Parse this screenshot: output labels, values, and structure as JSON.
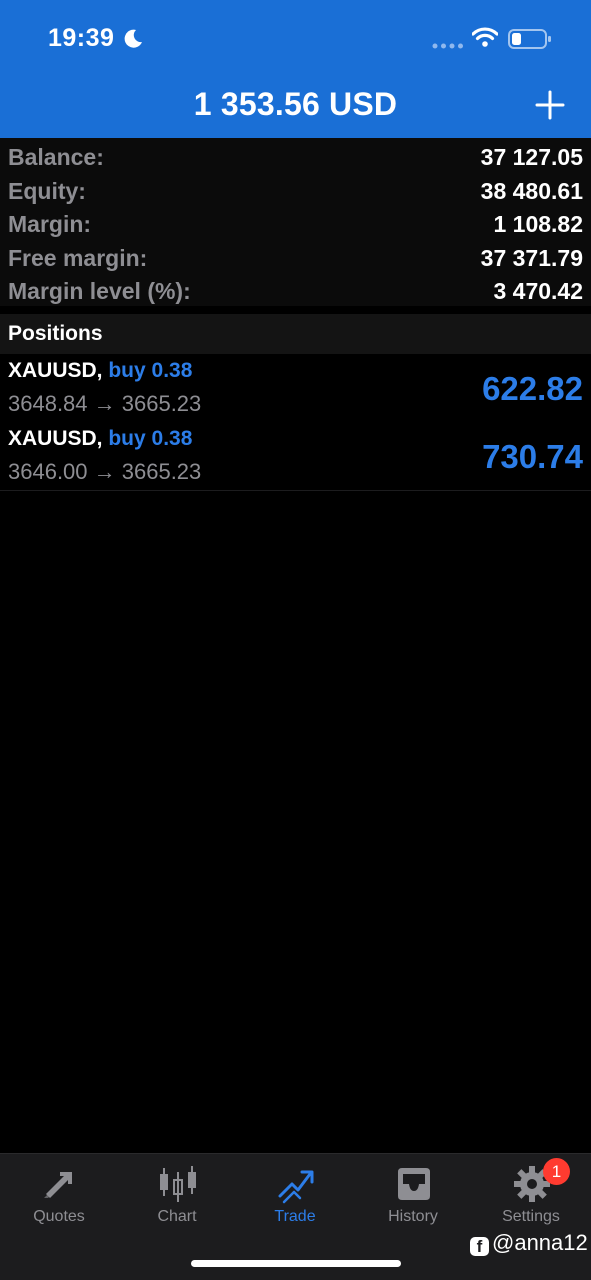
{
  "status_bar": {
    "time": "19:39"
  },
  "header": {
    "title": "1 353.56 USD"
  },
  "summary": [
    {
      "label": "Balance:",
      "value": "37 127.05"
    },
    {
      "label": "Equity:",
      "value": "38 480.61"
    },
    {
      "label": "Margin:",
      "value": "1 108.82"
    },
    {
      "label": "Free margin:",
      "value": "37 371.79"
    },
    {
      "label": "Margin level (%):",
      "value": "3 470.42"
    }
  ],
  "positions": {
    "header": "Positions",
    "items": [
      {
        "symbol": "XAUUSD,",
        "side": "buy 0.38",
        "prices": "3648.84 → 3665.23",
        "profit": "622.82"
      },
      {
        "symbol": "XAUUSD,",
        "side": "buy 0.38",
        "prices": "3646.00 → 3665.23",
        "profit": "730.74"
      }
    ]
  },
  "tabbar": {
    "tabs": [
      {
        "label": "Quotes",
        "icon": "quotes-icon"
      },
      {
        "label": "Chart",
        "icon": "candlestick-icon"
      },
      {
        "label": "Trade",
        "icon": "trade-icon",
        "active": true
      },
      {
        "label": "History",
        "icon": "inbox-icon"
      },
      {
        "label": "Settings",
        "icon": "gear-icon",
        "badge": "1"
      }
    ]
  },
  "watermark": {
    "text": "@anna12"
  },
  "colors": {
    "header_bg": "#1a6fd6",
    "accent": "#2c7de8",
    "badge": "#ff3b30"
  }
}
